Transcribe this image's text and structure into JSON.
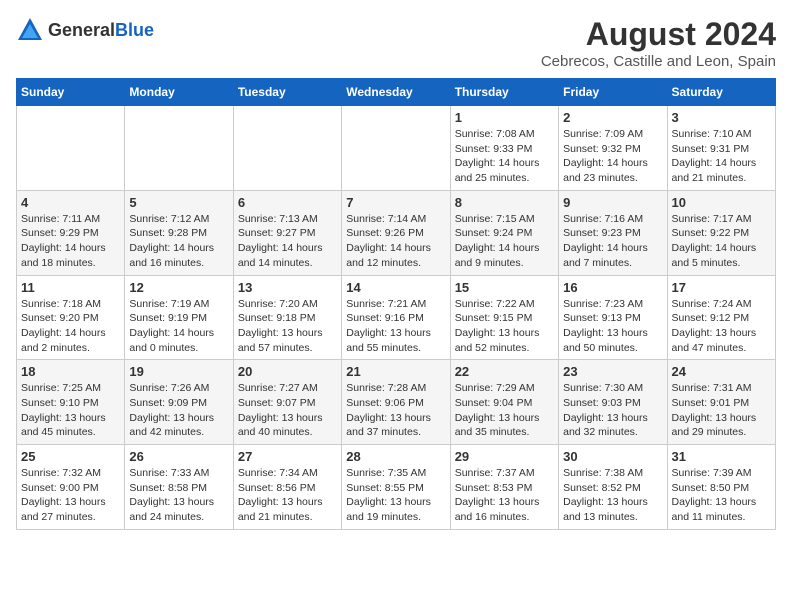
{
  "header": {
    "logo_general": "General",
    "logo_blue": "Blue",
    "title": "August 2024",
    "subtitle": "Cebrecos, Castille and Leon, Spain"
  },
  "weekdays": [
    "Sunday",
    "Monday",
    "Tuesday",
    "Wednesday",
    "Thursday",
    "Friday",
    "Saturday"
  ],
  "weeks": [
    [
      {
        "day": "",
        "sunrise": "",
        "sunset": "",
        "daylight": ""
      },
      {
        "day": "",
        "sunrise": "",
        "sunset": "",
        "daylight": ""
      },
      {
        "day": "",
        "sunrise": "",
        "sunset": "",
        "daylight": ""
      },
      {
        "day": "",
        "sunrise": "",
        "sunset": "",
        "daylight": ""
      },
      {
        "day": "1",
        "sunrise": "Sunrise: 7:08 AM",
        "sunset": "Sunset: 9:33 PM",
        "daylight": "Daylight: 14 hours and 25 minutes."
      },
      {
        "day": "2",
        "sunrise": "Sunrise: 7:09 AM",
        "sunset": "Sunset: 9:32 PM",
        "daylight": "Daylight: 14 hours and 23 minutes."
      },
      {
        "day": "3",
        "sunrise": "Sunrise: 7:10 AM",
        "sunset": "Sunset: 9:31 PM",
        "daylight": "Daylight: 14 hours and 21 minutes."
      }
    ],
    [
      {
        "day": "4",
        "sunrise": "Sunrise: 7:11 AM",
        "sunset": "Sunset: 9:29 PM",
        "daylight": "Daylight: 14 hours and 18 minutes."
      },
      {
        "day": "5",
        "sunrise": "Sunrise: 7:12 AM",
        "sunset": "Sunset: 9:28 PM",
        "daylight": "Daylight: 14 hours and 16 minutes."
      },
      {
        "day": "6",
        "sunrise": "Sunrise: 7:13 AM",
        "sunset": "Sunset: 9:27 PM",
        "daylight": "Daylight: 14 hours and 14 minutes."
      },
      {
        "day": "7",
        "sunrise": "Sunrise: 7:14 AM",
        "sunset": "Sunset: 9:26 PM",
        "daylight": "Daylight: 14 hours and 12 minutes."
      },
      {
        "day": "8",
        "sunrise": "Sunrise: 7:15 AM",
        "sunset": "Sunset: 9:24 PM",
        "daylight": "Daylight: 14 hours and 9 minutes."
      },
      {
        "day": "9",
        "sunrise": "Sunrise: 7:16 AM",
        "sunset": "Sunset: 9:23 PM",
        "daylight": "Daylight: 14 hours and 7 minutes."
      },
      {
        "day": "10",
        "sunrise": "Sunrise: 7:17 AM",
        "sunset": "Sunset: 9:22 PM",
        "daylight": "Daylight: 14 hours and 5 minutes."
      }
    ],
    [
      {
        "day": "11",
        "sunrise": "Sunrise: 7:18 AM",
        "sunset": "Sunset: 9:20 PM",
        "daylight": "Daylight: 14 hours and 2 minutes."
      },
      {
        "day": "12",
        "sunrise": "Sunrise: 7:19 AM",
        "sunset": "Sunset: 9:19 PM",
        "daylight": "Daylight: 14 hours and 0 minutes."
      },
      {
        "day": "13",
        "sunrise": "Sunrise: 7:20 AM",
        "sunset": "Sunset: 9:18 PM",
        "daylight": "Daylight: 13 hours and 57 minutes."
      },
      {
        "day": "14",
        "sunrise": "Sunrise: 7:21 AM",
        "sunset": "Sunset: 9:16 PM",
        "daylight": "Daylight: 13 hours and 55 minutes."
      },
      {
        "day": "15",
        "sunrise": "Sunrise: 7:22 AM",
        "sunset": "Sunset: 9:15 PM",
        "daylight": "Daylight: 13 hours and 52 minutes."
      },
      {
        "day": "16",
        "sunrise": "Sunrise: 7:23 AM",
        "sunset": "Sunset: 9:13 PM",
        "daylight": "Daylight: 13 hours and 50 minutes."
      },
      {
        "day": "17",
        "sunrise": "Sunrise: 7:24 AM",
        "sunset": "Sunset: 9:12 PM",
        "daylight": "Daylight: 13 hours and 47 minutes."
      }
    ],
    [
      {
        "day": "18",
        "sunrise": "Sunrise: 7:25 AM",
        "sunset": "Sunset: 9:10 PM",
        "daylight": "Daylight: 13 hours and 45 minutes."
      },
      {
        "day": "19",
        "sunrise": "Sunrise: 7:26 AM",
        "sunset": "Sunset: 9:09 PM",
        "daylight": "Daylight: 13 hours and 42 minutes."
      },
      {
        "day": "20",
        "sunrise": "Sunrise: 7:27 AM",
        "sunset": "Sunset: 9:07 PM",
        "daylight": "Daylight: 13 hours and 40 minutes."
      },
      {
        "day": "21",
        "sunrise": "Sunrise: 7:28 AM",
        "sunset": "Sunset: 9:06 PM",
        "daylight": "Daylight: 13 hours and 37 minutes."
      },
      {
        "day": "22",
        "sunrise": "Sunrise: 7:29 AM",
        "sunset": "Sunset: 9:04 PM",
        "daylight": "Daylight: 13 hours and 35 minutes."
      },
      {
        "day": "23",
        "sunrise": "Sunrise: 7:30 AM",
        "sunset": "Sunset: 9:03 PM",
        "daylight": "Daylight: 13 hours and 32 minutes."
      },
      {
        "day": "24",
        "sunrise": "Sunrise: 7:31 AM",
        "sunset": "Sunset: 9:01 PM",
        "daylight": "Daylight: 13 hours and 29 minutes."
      }
    ],
    [
      {
        "day": "25",
        "sunrise": "Sunrise: 7:32 AM",
        "sunset": "Sunset: 9:00 PM",
        "daylight": "Daylight: 13 hours and 27 minutes."
      },
      {
        "day": "26",
        "sunrise": "Sunrise: 7:33 AM",
        "sunset": "Sunset: 8:58 PM",
        "daylight": "Daylight: 13 hours and 24 minutes."
      },
      {
        "day": "27",
        "sunrise": "Sunrise: 7:34 AM",
        "sunset": "Sunset: 8:56 PM",
        "daylight": "Daylight: 13 hours and 21 minutes."
      },
      {
        "day": "28",
        "sunrise": "Sunrise: 7:35 AM",
        "sunset": "Sunset: 8:55 PM",
        "daylight": "Daylight: 13 hours and 19 minutes."
      },
      {
        "day": "29",
        "sunrise": "Sunrise: 7:37 AM",
        "sunset": "Sunset: 8:53 PM",
        "daylight": "Daylight: 13 hours and 16 minutes."
      },
      {
        "day": "30",
        "sunrise": "Sunrise: 7:38 AM",
        "sunset": "Sunset: 8:52 PM",
        "daylight": "Daylight: 13 hours and 13 minutes."
      },
      {
        "day": "31",
        "sunrise": "Sunrise: 7:39 AM",
        "sunset": "Sunset: 8:50 PM",
        "daylight": "Daylight: 13 hours and 11 minutes."
      }
    ]
  ]
}
